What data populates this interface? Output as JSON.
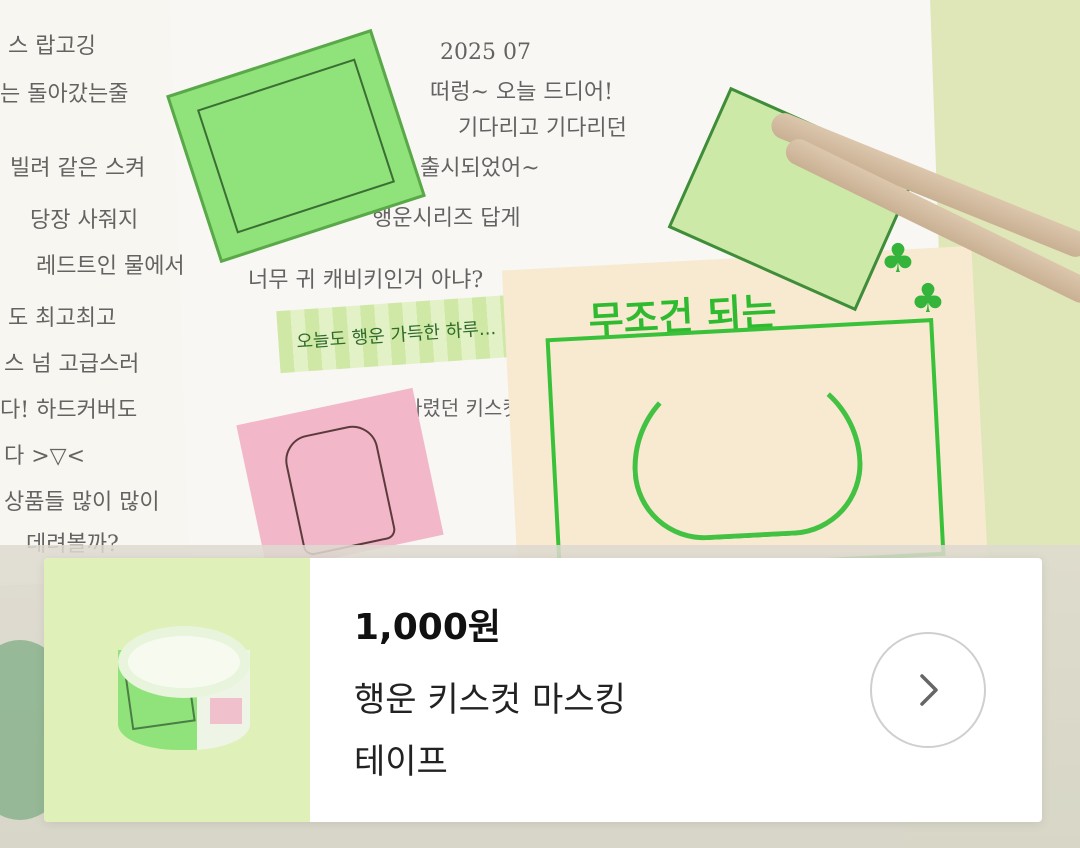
{
  "product": {
    "price": "1,000원",
    "title_line1": "행운 키스컷 마스킹",
    "title_line2": "테이프",
    "next_icon": "chevron-right-icon"
  },
  "background_text": {
    "date": "2025 07",
    "line1": "떠렁~ 오늘 드디어!",
    "line2": "기다리고 기다리던",
    "line3": "출시되었어~",
    "line4": "행운시리즈 답게",
    "line5": "너무 귀 캐비키인거 아냐?",
    "tape_text": "오늘도 행운 가득한 하루...",
    "quote": "\" 기다렸던 키스컷 아테 \"",
    "card_title": "무조건 되는",
    "left1": "스 랍고깅",
    "left2": "는 돌아갔는줄",
    "left3": "빌려 같은 스켜",
    "left4": "당장 사줘지",
    "left5": "레드트인 물에서",
    "left6": "도 최고최고",
    "left7": "스 넘 고급스러",
    "left8": "다! 하드커버도",
    "left9": "다 >▽<",
    "left10": "상품들 많이 많이",
    "left11": "데려볼까?"
  }
}
